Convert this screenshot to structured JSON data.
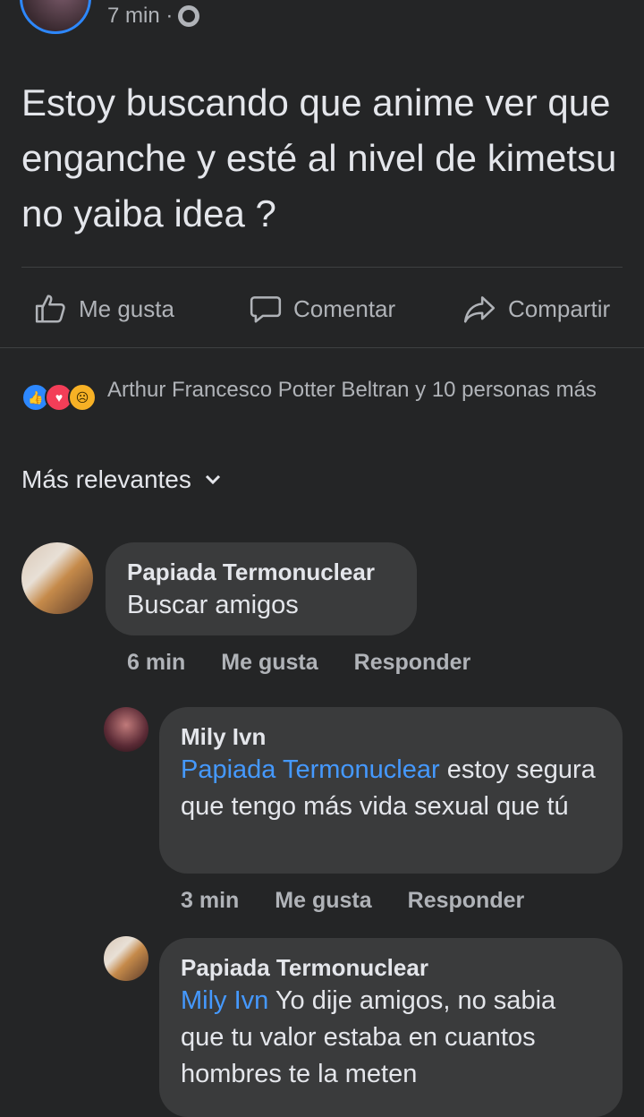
{
  "post": {
    "time": "7 min ·",
    "text": "Estoy buscando que anime ver que enganche y esté al nivel de kimetsu no yaiba idea ?"
  },
  "actions": {
    "like": "Me gusta",
    "comment": "Comentar",
    "share": "Compartir"
  },
  "reactions": {
    "text": "Arthur Francesco Potter Beltran y 10 personas más"
  },
  "sort": {
    "label": "Más relevantes"
  },
  "comments": [
    {
      "name": "Papiada Termonuclear",
      "text": "Buscar amigos",
      "time": "6 min",
      "like": "Me gusta",
      "reply": "Responder"
    },
    {
      "name": "Mily Ivn",
      "mention": "Papiada Termonuclear",
      "text": " estoy segura que tengo más vida sexual que tú",
      "time": "3 min",
      "like": "Me gusta",
      "reply": "Responder"
    },
    {
      "name": "Papiada Termonuclear",
      "mention": "Mily Ivn",
      "text": " Yo dije amigos, no sabia que tu valor estaba en cuantos hombres te la meten"
    }
  ],
  "colors": {
    "background": "#242526",
    "bubble": "#3a3b3c",
    "mention": "#4599ff",
    "like": "#2d88ff",
    "love": "#f33e58",
    "sad": "#f7b125"
  }
}
